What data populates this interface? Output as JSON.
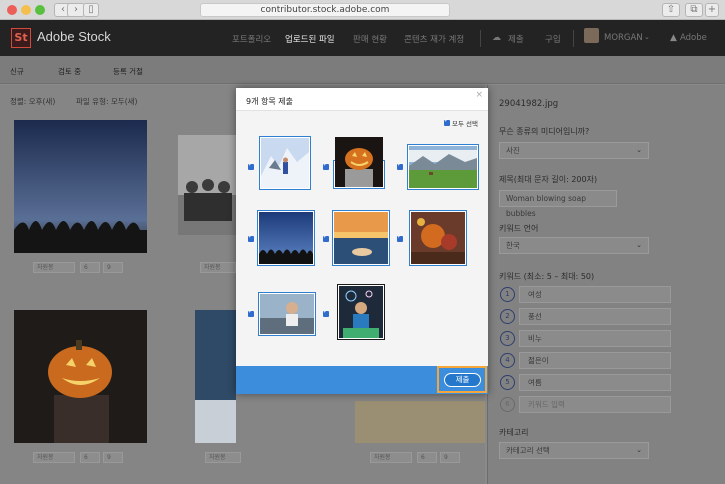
{
  "browser": {
    "url": "contributor.stock.adobe.com"
  },
  "header": {
    "brand": "Adobe Stock",
    "logo": "St",
    "nav": [
      "포트폴리오",
      "업로드된 파일",
      "판매 현황",
      "콘텐츠 재가 계정"
    ],
    "active_nav": "업로드된 파일",
    "upload_label": "제출",
    "guide_label": "구입",
    "user_name": "MORGAN",
    "adobe_label": "Adobe"
  },
  "subtabs": [
    "신규",
    "검토 중",
    "등록 거절"
  ],
  "filters": {
    "sort": "정렬: 오후(새)",
    "type": "파일 유형: 모두(새)"
  },
  "thumb_bar": {
    "label": "자원봉",
    "count1": "6",
    "count2": "9"
  },
  "modal": {
    "title": "9개 항목 제출",
    "select_all": "모두 선택",
    "submit_label": "제출",
    "close_glyph": "×"
  },
  "right_panel": {
    "filename": "29041982.jpg",
    "q_type": "무슨 종류의 미디어입니까?",
    "type_value": "사진",
    "title_label": "제목(최대 문자 길이: 200자)",
    "title_value": "Woman blowing soap bubbles",
    "keyword_lang_label": "키워드 언어",
    "keyword_lang_value": "한국",
    "keywords_label": "키워드 (최소: 5 – 최대: 50)",
    "keywords": [
      {
        "num": "1",
        "text": "여성"
      },
      {
        "num": "2",
        "text": "풍선"
      },
      {
        "num": "3",
        "text": "비누"
      },
      {
        "num": "4",
        "text": "젊은이"
      },
      {
        "num": "5",
        "text": "여름"
      },
      {
        "num": "6",
        "text": "키워드 입력"
      }
    ],
    "category_label": "카테고리",
    "category_value": "카테고리 선택"
  },
  "colors": {
    "accent": "#3c8ddc",
    "highlight": "#f4a63a",
    "checkbox": "#2f6ccd"
  }
}
